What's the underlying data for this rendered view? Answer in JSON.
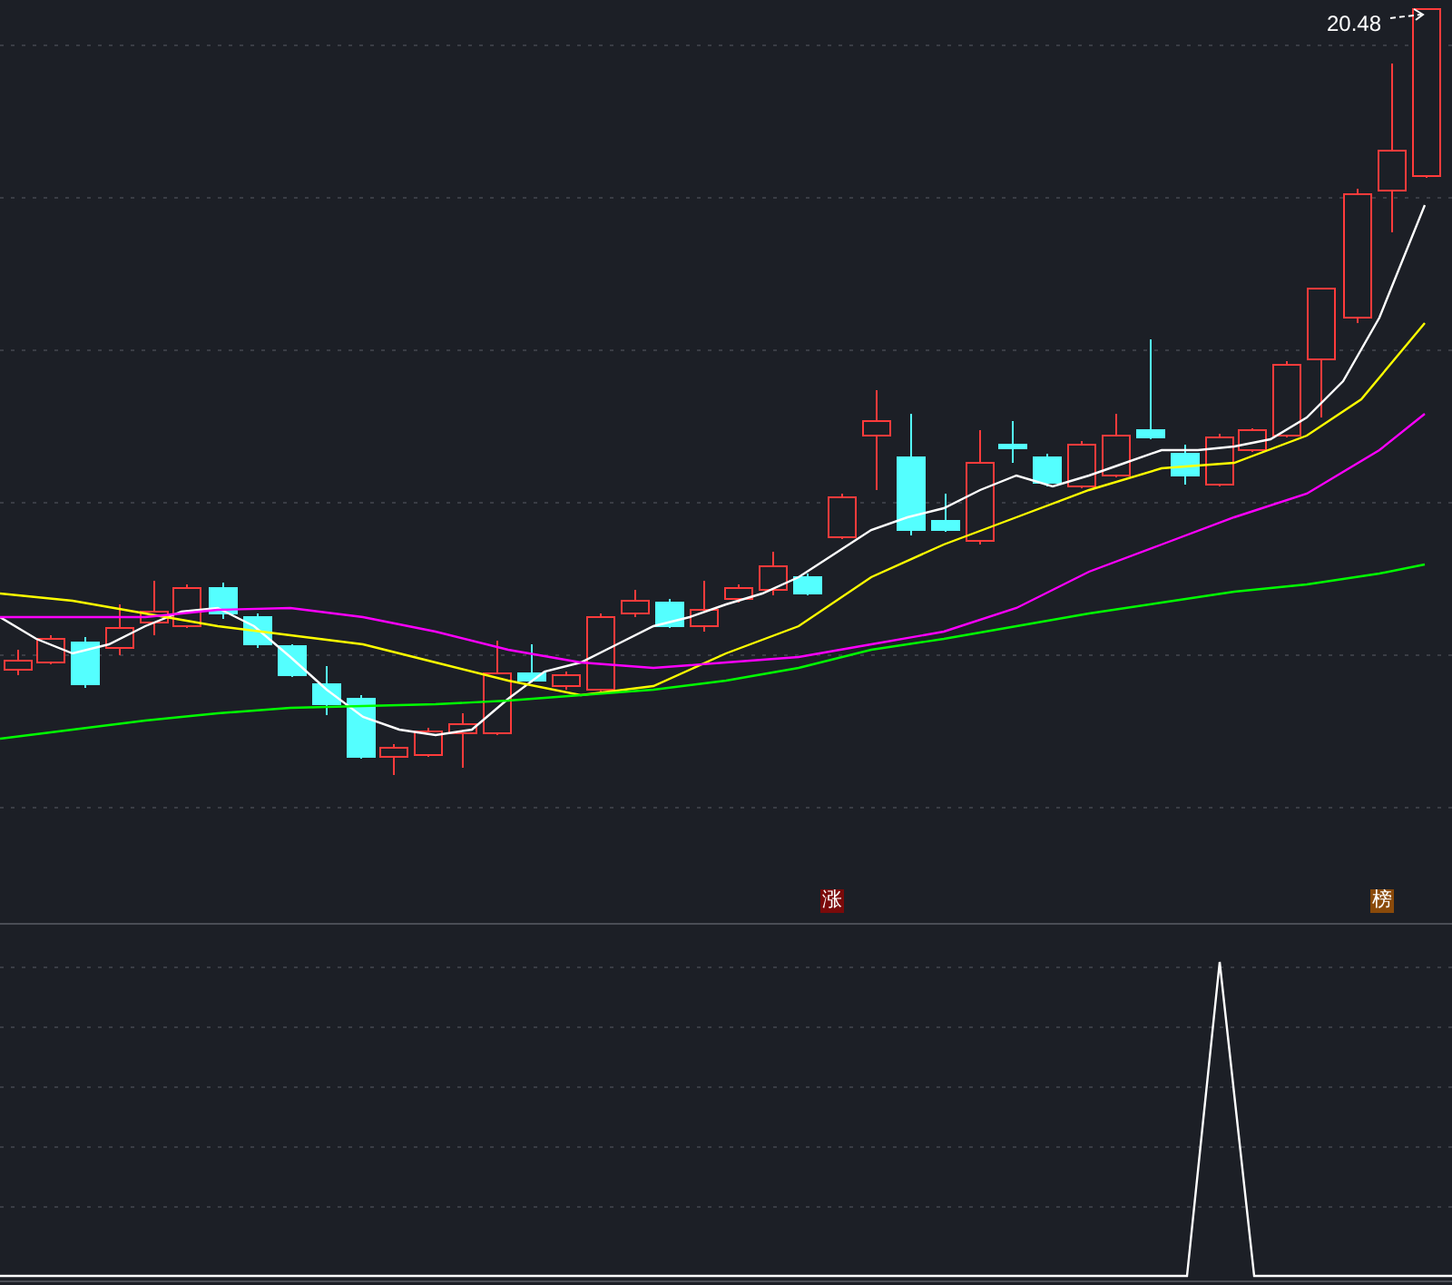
{
  "price_chart": {
    "high_label": "20.48",
    "markers": [
      {
        "text": "涨",
        "color": "#7a0a0a"
      },
      {
        "text": "榜",
        "color": "#8a4a0a"
      }
    ]
  }
}
